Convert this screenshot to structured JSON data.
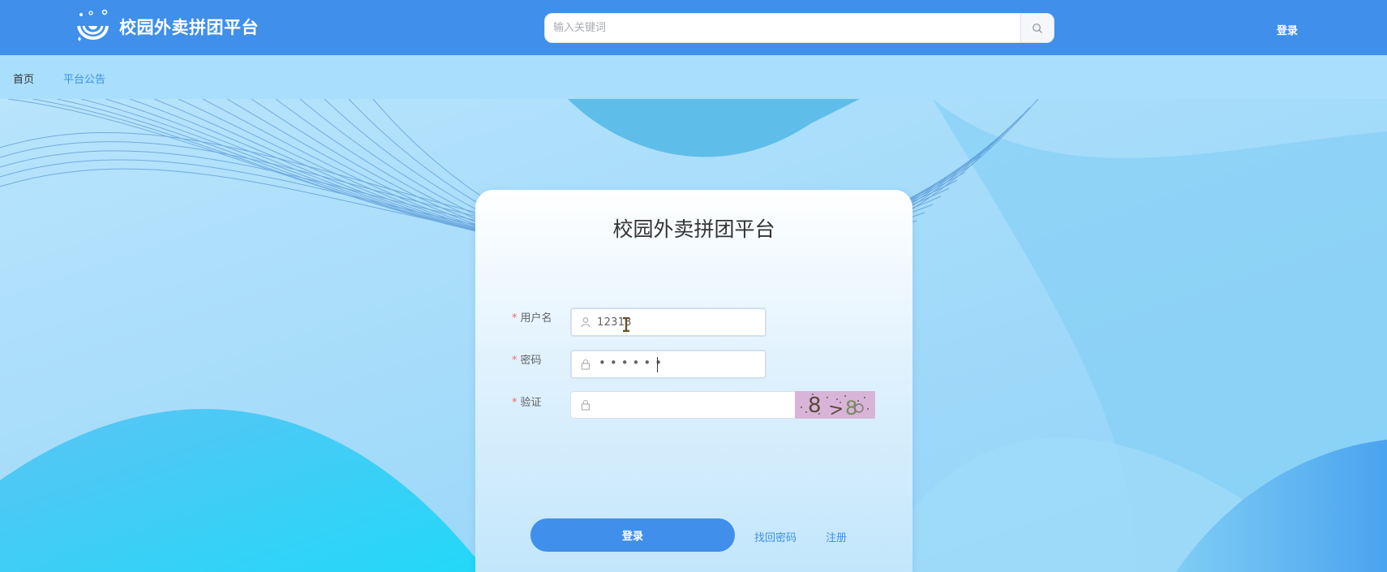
{
  "header": {
    "brand": "校园外卖拼团平台",
    "search_placeholder": "输入关键词",
    "login_label": "登录"
  },
  "nav": {
    "items": [
      {
        "label": "首页"
      },
      {
        "label": "平台公告"
      }
    ]
  },
  "login_form": {
    "title": "校园外卖拼团平台",
    "username_label": "用户名",
    "username_value": "12313",
    "password_label": "密码",
    "password_mask": "••••••",
    "captcha_label": "验证",
    "captcha_text": "8 > 8",
    "submit_label": "登录",
    "forgot_label": "找回密码",
    "register_label": "注册"
  },
  "colors": {
    "primary": "#3f8feb",
    "nav_bg": "#a9dffd",
    "required_star": "#f56c6c"
  }
}
